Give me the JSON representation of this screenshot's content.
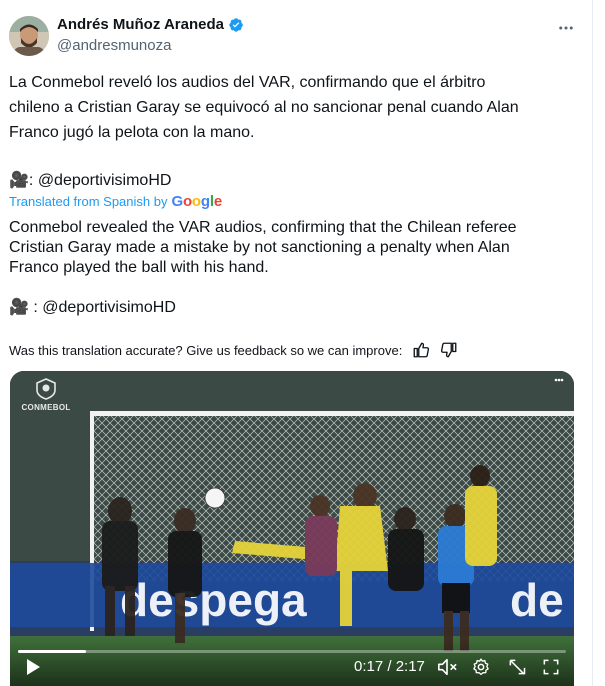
{
  "author": {
    "display_name": "Andrés Muñoz Araneda",
    "handle": "@andresmunoza",
    "verified_icon": "verified-badge-icon"
  },
  "tweet": {
    "line1": "La Conmebol reveló los audios del VAR, confirmando que el árbitro",
    "line2": "chileno a Cristian Garay se equivocó al no sancionar penal cuando Alan",
    "line3": "Franco jugó la pelota con la mano.",
    "camera_emoji": "🎥",
    "camera_handle": ": @deportivisimoHD"
  },
  "translation": {
    "label": "Translated from Spanish by",
    "provider": [
      "G",
      "o",
      "o",
      "g",
      "l",
      "e"
    ],
    "line1": "Conmebol revealed the VAR audios, confirming that the Chilean referee",
    "line2": "Cristian Garay made a mistake by not sanctioning a penalty when Alan",
    "line3": "Franco played the ball with his hand.",
    "camera_emoji": "🎥",
    "camera_handle": " : @deportivisimoHD",
    "feedback_prompt": "Was this translation accurate? Give us feedback so we can improve:"
  },
  "video": {
    "logo_text": "CONMEBOL",
    "time": "0:17 / 2:17",
    "progress": 0.124,
    "ad_text": "despega"
  },
  "colors": {
    "accent": "#1d9bf0",
    "text": "#0f1419",
    "muted": "#536471"
  }
}
